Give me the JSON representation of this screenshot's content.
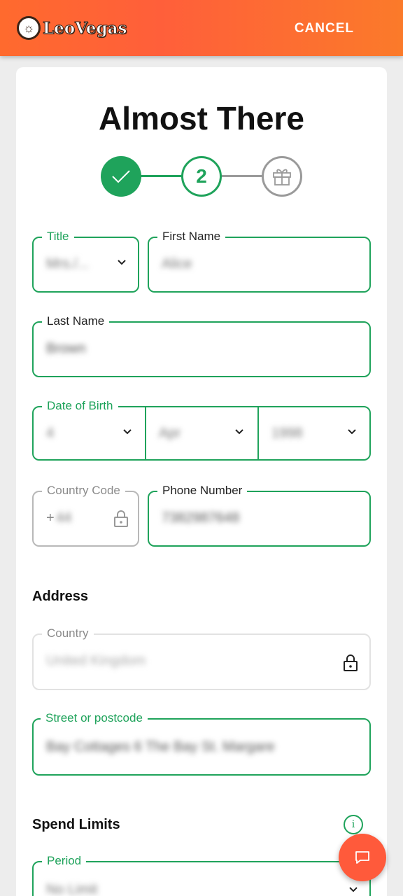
{
  "header": {
    "logo_text": "LeoVegas",
    "cancel_label": "CANCEL"
  },
  "page": {
    "title": "Almost There"
  },
  "stepper": {
    "step2_label": "2"
  },
  "fields": {
    "title": {
      "label": "Title",
      "value": "Mrs./..."
    },
    "first_name": {
      "label": "First Name",
      "value": "Alice"
    },
    "last_name": {
      "label": "Last Name",
      "value": "Brown"
    },
    "dob": {
      "label": "Date of Birth",
      "day": "4",
      "month": "Apr",
      "year": "1998"
    },
    "country_code": {
      "label": "Country Code",
      "prefix": "+",
      "value": "44"
    },
    "phone": {
      "label": "Phone Number",
      "value": "7382987648"
    },
    "country": {
      "label": "Country",
      "value": "United Kingdom"
    },
    "street": {
      "label": "Street or postcode",
      "value": "Bay Cottages 6 The Bay St. Margare"
    },
    "period": {
      "label": "Period",
      "value": "No Limit"
    }
  },
  "sections": {
    "address": "Address",
    "spend_limits": "Spend Limits"
  },
  "icons": {
    "info": "i"
  },
  "colors": {
    "brand_orange": "#ff5f3a",
    "accent_green": "#1fa35b"
  }
}
